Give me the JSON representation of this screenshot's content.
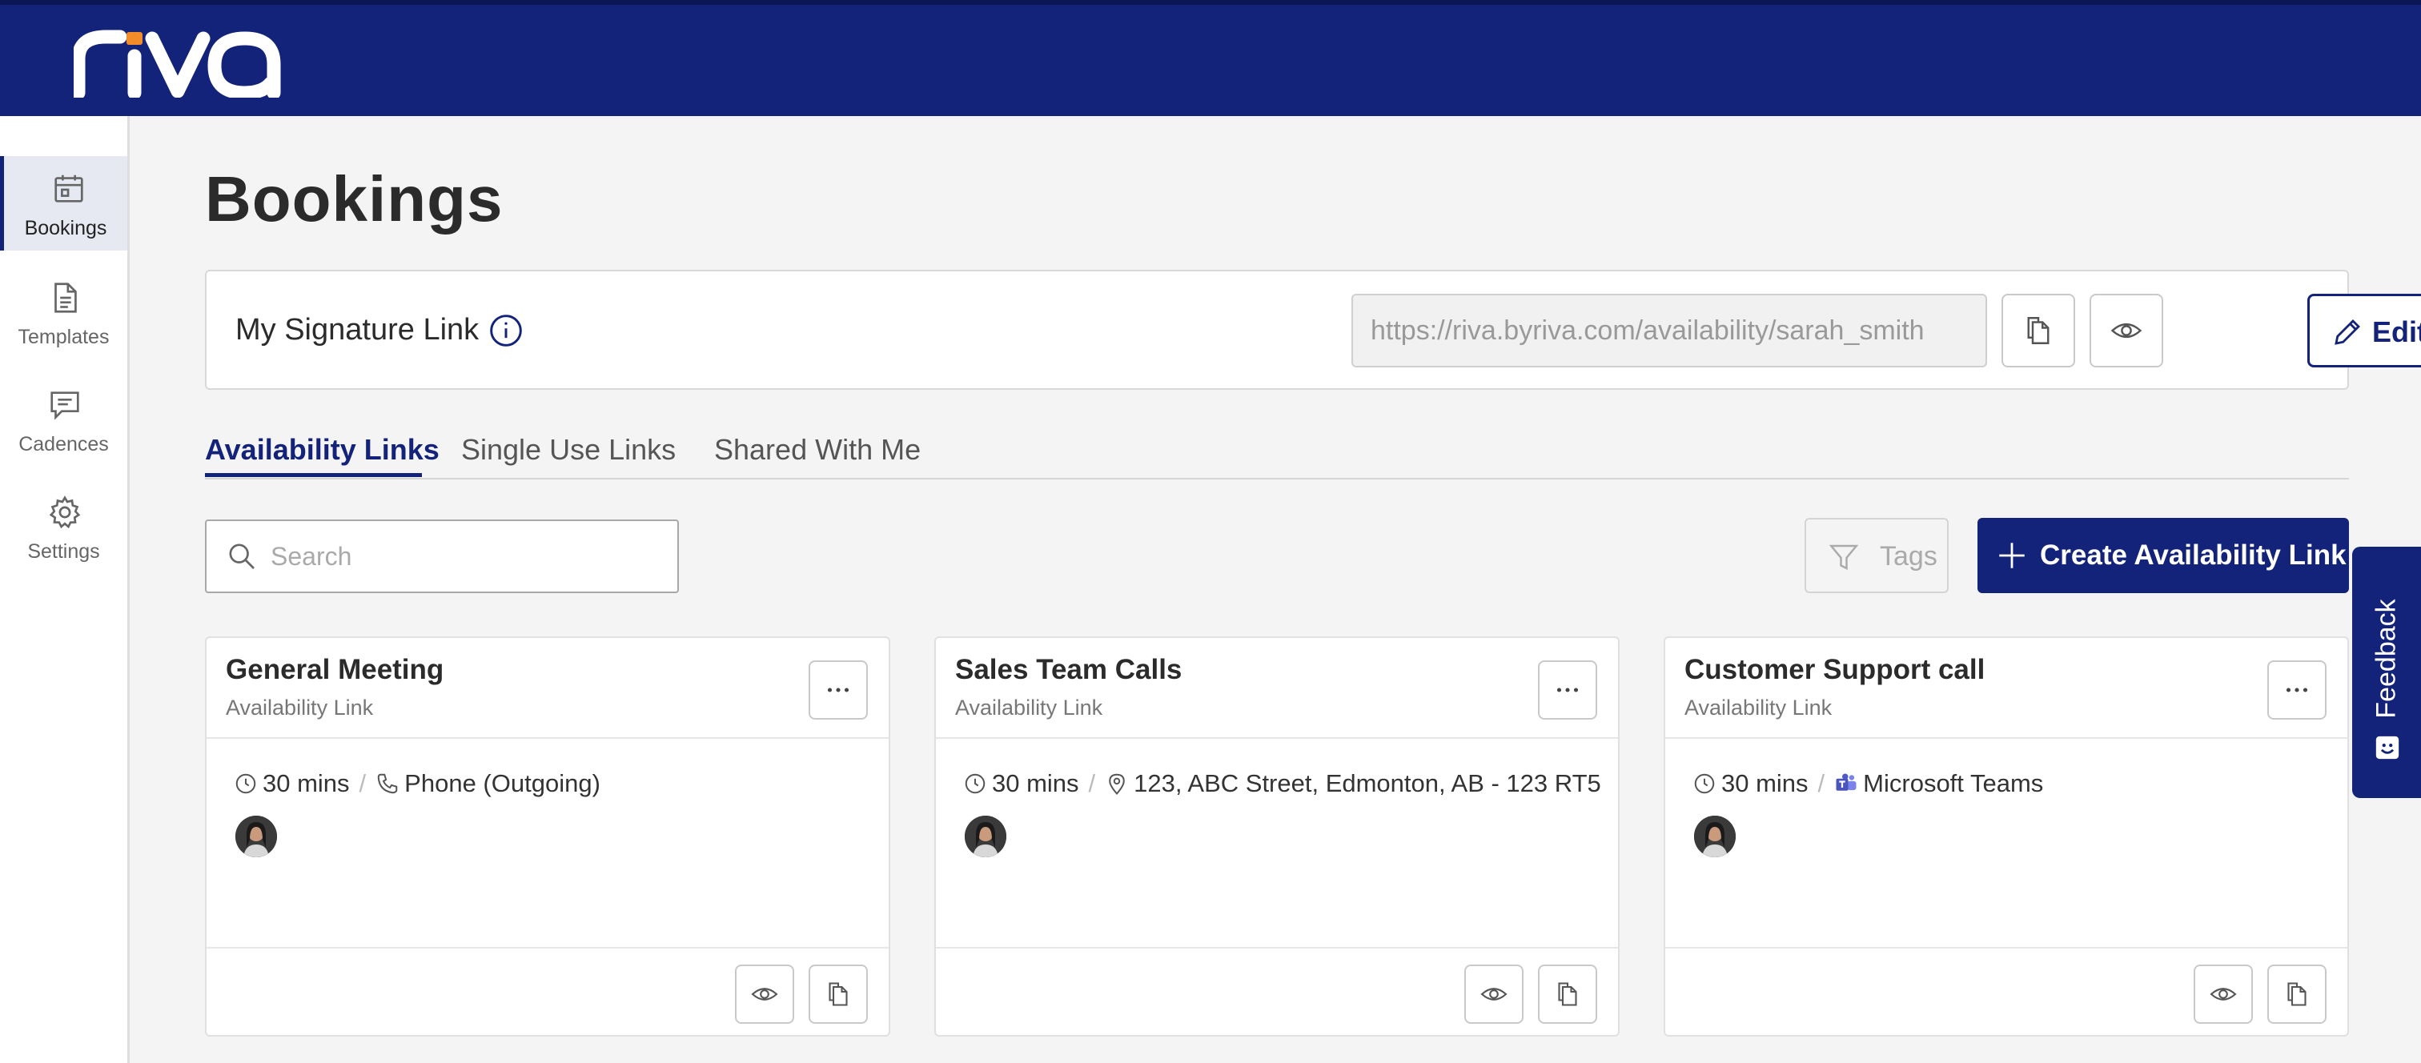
{
  "brand": {
    "logo_text": "riva",
    "topbar_color": "#14237a",
    "logo_accent": "#f28c28"
  },
  "sidebar": {
    "items": [
      {
        "label": "Bookings",
        "icon": "calendar-icon",
        "active": true
      },
      {
        "label": "Templates",
        "icon": "document-icon",
        "active": false
      },
      {
        "label": "Cadences",
        "icon": "chat-icon",
        "active": false
      },
      {
        "label": "Settings",
        "icon": "gear-icon",
        "active": false
      }
    ]
  },
  "page": {
    "title": "Bookings"
  },
  "signature": {
    "label": "My Signature Link",
    "url": "https://riva.byriva.com/availability/sarah_smith",
    "edit_label": "Edit"
  },
  "tabs": [
    {
      "label": "Availability Links",
      "active": true
    },
    {
      "label": "Single Use Links",
      "active": false
    },
    {
      "label": "Shared With Me",
      "active": false
    }
  ],
  "toolbar": {
    "search_placeholder": "Search",
    "tags_label": "Tags",
    "create_label": "Create Availability Link"
  },
  "cards": [
    {
      "title": "General Meeting",
      "subtitle": "Availability Link",
      "duration": "30 mins",
      "location": "Phone (Outgoing)",
      "location_icon": "phone-icon"
    },
    {
      "title": "Sales Team Calls",
      "subtitle": "Availability Link",
      "duration": "30 mins",
      "location": "123, ABC Street, Edmonton, AB - 123 RT5",
      "location_icon": "map-pin-icon"
    },
    {
      "title": "Customer Support call",
      "subtitle": "Availability Link",
      "duration": "30 mins",
      "location": "Microsoft Teams",
      "location_icon": "microsoft-teams-icon"
    }
  ],
  "feedback": {
    "label": "Feedback"
  }
}
